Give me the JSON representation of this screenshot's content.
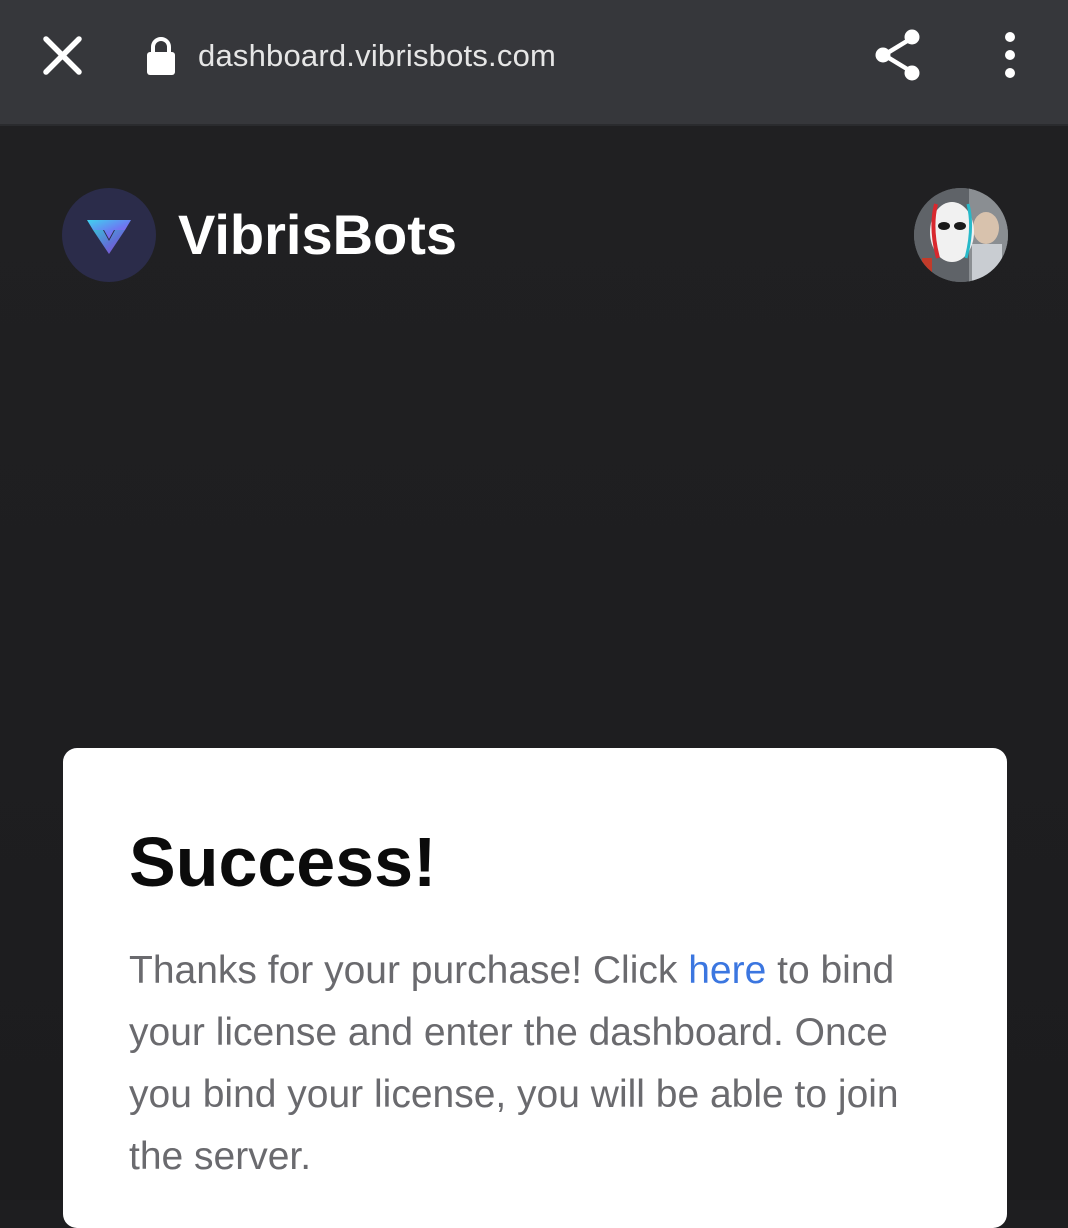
{
  "browser": {
    "url": "dashboard.vibrisbots.com",
    "close_icon": "close-icon",
    "lock_icon": "lock-icon",
    "share_icon": "share-icon",
    "menu_icon": "more-vertical-icon"
  },
  "header": {
    "brand_name": "VibrisBots",
    "logo_icon": "vibrisbots-logo",
    "avatar": "user-avatar"
  },
  "card": {
    "title": "Success!",
    "body_before_link": "Thanks for your purchase! Click ",
    "link_text": "here",
    "body_after_link": " to bind your license and enter the dashboard. Once you bind your license, you will be able to join the server."
  },
  "colors": {
    "browser_bar": "#36373b",
    "page_background": "#1e1e20",
    "card_background": "#ffffff",
    "link": "#3b76e0",
    "logo_background": "#2b2c4a"
  }
}
